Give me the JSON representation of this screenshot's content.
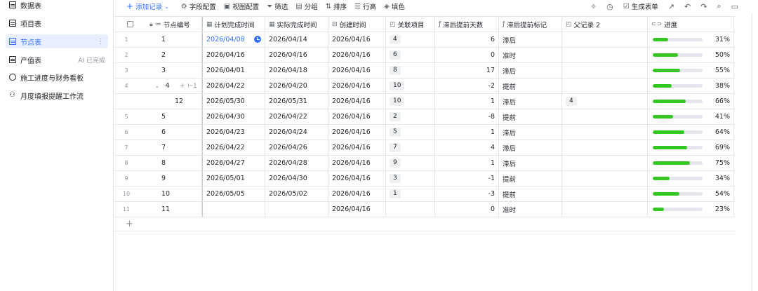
{
  "sidebar": {
    "items": [
      {
        "label": "数据表",
        "suffix": "",
        "active": false
      },
      {
        "label": "项目表",
        "suffix": "",
        "active": false
      },
      {
        "label": "节点表",
        "suffix": "⋮",
        "active": true
      },
      {
        "label": "产值表",
        "suffix": "AI 已完成",
        "active": false
      },
      {
        "label": "施工进度与财务看板",
        "suffix": "",
        "active": false
      },
      {
        "label": "月度填报提醒工作流",
        "suffix": "",
        "active": false
      }
    ]
  },
  "toolbar": {
    "add_record": "添加记录",
    "field_config": "字段配置",
    "view_config": "视图配置",
    "filter": "筛选",
    "group": "分组",
    "sort": "排序",
    "row_height": "行高",
    "fill_color": "填色",
    "generate_form": "生成表单"
  },
  "columns": {
    "num": "节点编号",
    "plan": "计划完成时间",
    "actual": "实际完成时间",
    "created": "创建时间",
    "related": "关联项目",
    "days": "滞后提前天数",
    "mark": "滞后提前标记",
    "parent": "父记录 2",
    "progress": "进度"
  },
  "rows": [
    {
      "idx": "1",
      "num": "1",
      "plan": "2026/04/08",
      "actual": "2026/04/14",
      "created": "2026/04/16",
      "related": "4",
      "days": "6",
      "mark": "滞后",
      "parent": "",
      "progress": 0.31,
      "pct": "31%"
    },
    {
      "idx": "2",
      "num": "2",
      "plan": "2026/04/16",
      "actual": "2026/04/16",
      "created": "2026/04/16",
      "related": "6",
      "days": "0",
      "mark": "准时",
      "parent": "",
      "progress": 0.5,
      "pct": "50%"
    },
    {
      "idx": "3",
      "num": "3",
      "plan": "2026/04/01",
      "actual": "2026/04/18",
      "created": "2026/04/16",
      "related": "8",
      "days": "17",
      "mark": "滞后",
      "parent": "",
      "progress": 0.55,
      "pct": "55%"
    },
    {
      "idx": "4",
      "num": "4",
      "plan": "2026/04/22",
      "actual": "2026/04/20",
      "created": "2026/04/16",
      "related": "10",
      "days": "-2",
      "mark": "提前",
      "parent": "",
      "progress": 0.38,
      "pct": "38%"
    },
    {
      "idx": "",
      "num": "12",
      "plan": "2026/05/30",
      "actual": "2026/05/31",
      "created": "2026/04/16",
      "related": "10",
      "days": "1",
      "mark": "滞后",
      "parent": "4",
      "progress": 0.66,
      "pct": "66%"
    },
    {
      "idx": "5",
      "num": "5",
      "plan": "2026/04/30",
      "actual": "2026/04/22",
      "created": "2026/04/16",
      "related": "2",
      "days": "-8",
      "mark": "提前",
      "parent": "",
      "progress": 0.41,
      "pct": "41%"
    },
    {
      "idx": "6",
      "num": "6",
      "plan": "2026/04/23",
      "actual": "2026/04/24",
      "created": "2026/04/16",
      "related": "5",
      "days": "1",
      "mark": "滞后",
      "parent": "",
      "progress": 0.64,
      "pct": "64%"
    },
    {
      "idx": "7",
      "num": "7",
      "plan": "2026/04/22",
      "actual": "2026/04/26",
      "created": "2026/04/16",
      "related": "7",
      "days": "4",
      "mark": "滞后",
      "parent": "",
      "progress": 0.69,
      "pct": "69%"
    },
    {
      "idx": "8",
      "num": "8",
      "plan": "2026/04/27",
      "actual": "2026/04/28",
      "created": "2026/04/16",
      "related": "9",
      "days": "1",
      "mark": "滞后",
      "parent": "",
      "progress": 0.75,
      "pct": "75%"
    },
    {
      "idx": "9",
      "num": "9",
      "plan": "2026/05/01",
      "actual": "2026/04/30",
      "created": "2026/04/16",
      "related": "3",
      "days": "-1",
      "mark": "提前",
      "parent": "",
      "progress": 0.34,
      "pct": "34%"
    },
    {
      "idx": "10",
      "num": "10",
      "plan": "2026/05/05",
      "actual": "2026/05/02",
      "created": "2026/04/16",
      "related": "1",
      "days": "-3",
      "mark": "提前",
      "parent": "",
      "progress": 0.54,
      "pct": "54%"
    },
    {
      "idx": "11",
      "num": "11",
      "plan": "",
      "actual": "",
      "created": "2026/04/16",
      "related": "",
      "days": "0",
      "mark": "准时",
      "parent": "",
      "progress": 0.23,
      "pct": "23%"
    }
  ],
  "colors": {
    "accent": "#3370ff",
    "progress": "#34c724"
  }
}
